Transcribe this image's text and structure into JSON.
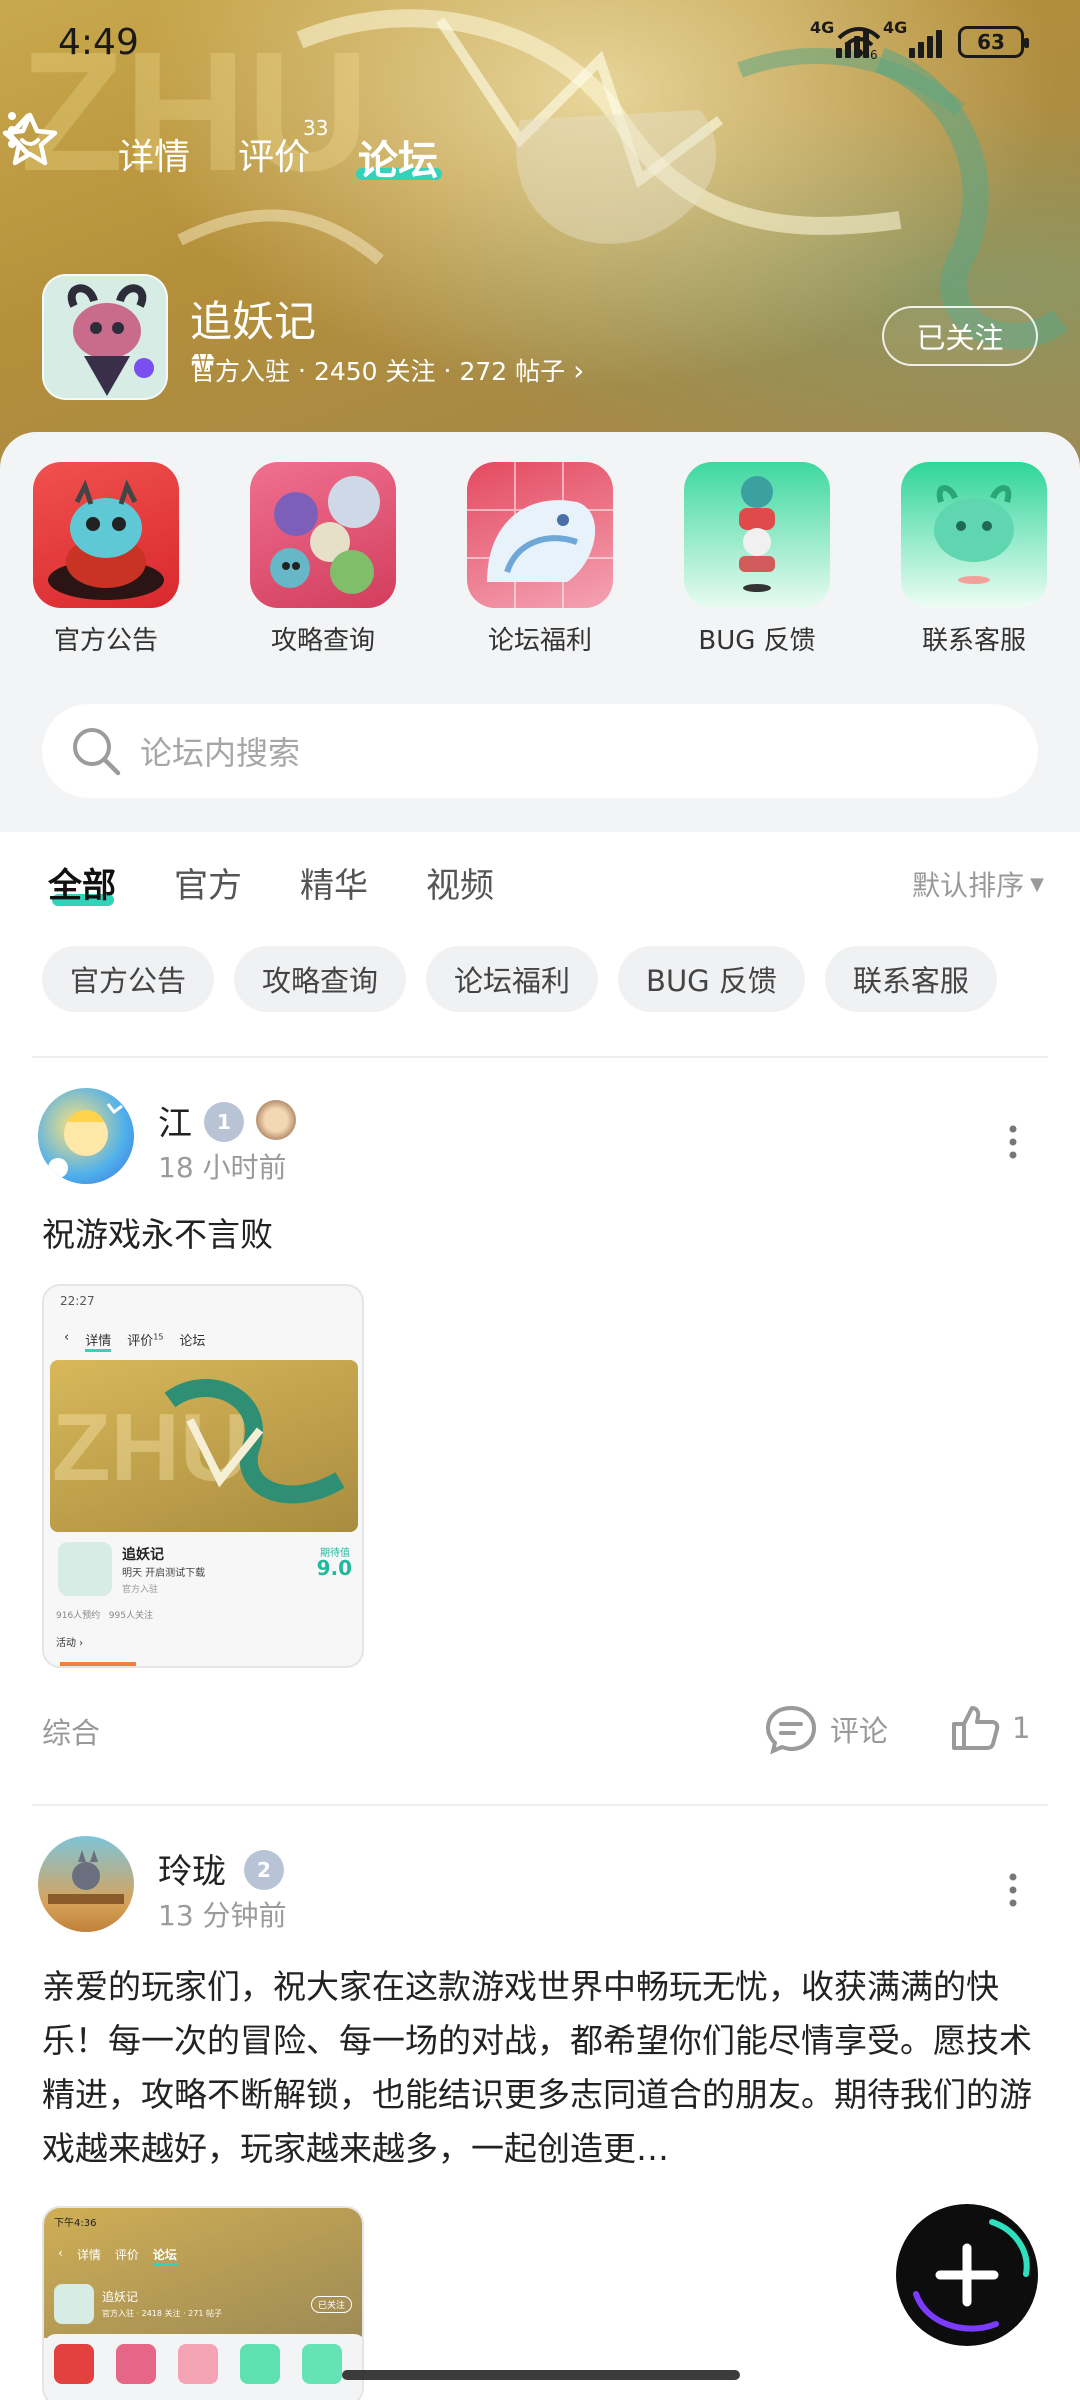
{
  "status_bar": {
    "time": "4:49",
    "signal_1": "4G",
    "signal_2": "4G",
    "wifi_sub": "6",
    "battery": "63"
  },
  "nav": {
    "tabs": [
      "详情",
      "评价",
      "论坛"
    ],
    "review_count": "33",
    "active_tab": "论坛"
  },
  "app": {
    "name": "追妖记",
    "official": "官方入驻",
    "followers": "2450 关注",
    "posts": "272 帖子",
    "separator": "·",
    "follow_button": "已关注"
  },
  "categories": [
    {
      "label": "官方公告",
      "icon": "red-monster-icon"
    },
    {
      "label": "攻略查询",
      "icon": "monster-group-icon"
    },
    {
      "label": "论坛福利",
      "icon": "white-dragon-icon"
    },
    {
      "label": "BUG 反馈",
      "icon": "totem-icon"
    },
    {
      "label": "联系客服",
      "icon": "green-spirit-icon"
    }
  ],
  "search": {
    "placeholder": "论坛内搜索"
  },
  "feed_tabs": [
    "全部",
    "官方",
    "精华",
    "视频"
  ],
  "sort": "默认排序",
  "chips": [
    "官方公告",
    "攻略查询",
    "论坛福利",
    "BUG 反馈",
    "联系客服"
  ],
  "posts": [
    {
      "user": "江",
      "level": "1",
      "time": "18 小时前",
      "text": "祝游戏永不言败",
      "tag": "综合",
      "comment_label": "评论",
      "likes": "1",
      "thumb": {
        "time": "22:27",
        "tabs": [
          "详情",
          "评价",
          "论坛"
        ],
        "review_count": "15",
        "name": "追妖记",
        "sub": "明天 开启测试下载",
        "official": "官方入驻",
        "score_label": "期待值",
        "score": "9.0",
        "stats": "916人预约   995人关注",
        "activity": "活动"
      }
    },
    {
      "user": "玲珑",
      "level": "2",
      "time": "13 分钟前",
      "text": "亲爱的玩家们，祝大家在这款游戏世界中畅玩无忧，收获满满的快乐！每一次的冒险、每一场的对战，都希望你们能尽情享受。愿技术精进，攻略不断解锁，也能结识更多志同道合的朋友。期待我们的游戏越来越好，玩家越来越多，一起创造更…",
      "thumb": {
        "time": "下午4:36",
        "tabs": [
          "详情",
          "评价",
          "论坛"
        ],
        "name": "追妖记",
        "meta": "官方入驻 · 2418 关注 · 271 帖子",
        "follow": "已关注"
      }
    }
  ],
  "colors": {
    "accent": "#31d3b9",
    "hero": "#b48f3a"
  }
}
